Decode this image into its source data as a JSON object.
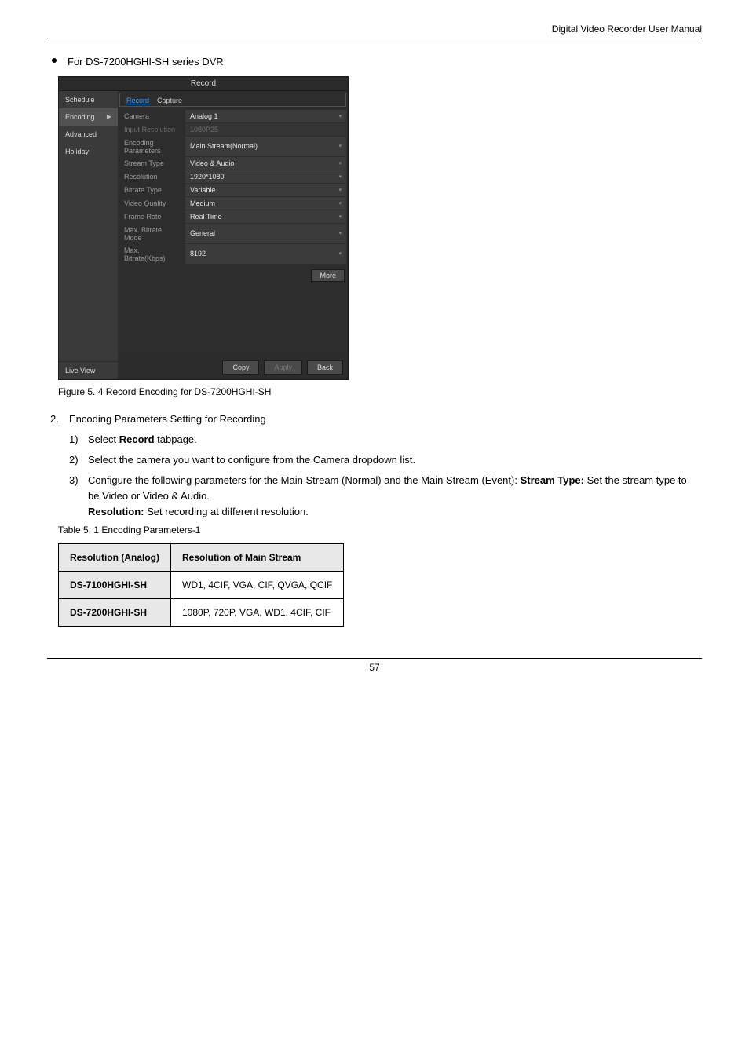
{
  "header": {
    "right": "Digital Video Recorder User Manual"
  },
  "bullet": {
    "text_before": "For ",
    "series": "DS-7200HGHI-SH",
    "text_after": " series DVR:"
  },
  "screenshot": {
    "title": "Record",
    "sidebar": {
      "items": [
        {
          "label": "Schedule",
          "active": false
        },
        {
          "label": "Encoding",
          "active": true
        },
        {
          "label": "Advanced",
          "active": false
        },
        {
          "label": "Holiday",
          "active": false
        }
      ],
      "bottom": "Live View"
    },
    "tabs": [
      {
        "label": "Record",
        "active": true
      },
      {
        "label": "Capture",
        "active": false
      }
    ],
    "rows": [
      {
        "label": "Camera",
        "value": "Analog 1",
        "dd": true
      },
      {
        "label": "Input Resolution",
        "value": "1080P25",
        "dim": true
      },
      {
        "label": "Encoding Parameters",
        "value": "Main Stream(Normal)",
        "dd": true
      },
      {
        "label": "Stream Type",
        "value": "Video & Audio",
        "dd": true
      },
      {
        "label": "Resolution",
        "value": "1920*1080",
        "dd": true
      },
      {
        "label": "Bitrate Type",
        "value": "Variable",
        "dd": true
      },
      {
        "label": "Video Quality",
        "value": "Medium",
        "dd": true
      },
      {
        "label": "Frame Rate",
        "value": "Real Time",
        "dd": true
      },
      {
        "label": "Max. Bitrate Mode",
        "value": "General",
        "dd": true
      },
      {
        "label": "Max. Bitrate(Kbps)",
        "value": "8192",
        "dd": true
      }
    ],
    "more": "More",
    "buttons": {
      "copy": "Copy",
      "apply": "Apply",
      "back": "Back"
    }
  },
  "figure_caption": "Figure 5. 4 Record Encoding for DS-7200HGHI-SH",
  "steps": {
    "s2": {
      "num": "2.",
      "text": "Encoding Parameters Setting for Recording"
    },
    "s2_1": {
      "num": "1)",
      "text": " tabpage."
    }
  },
  "table_caption": "Table 5. 1 Encoding Parameters-1",
  "table": {
    "h1": "Resolution (Analog)",
    "h2": "Resolution of Main Stream",
    "r1c1": "DS-7100HGHI-SH",
    "r1c2": "WD1, 4CIF, VGA, CIF, QVGA, QCIF",
    "r2c1": "DS-7200HGHI-SH",
    "r2c2": "1080P, 720P, VGA, WD1, 4CIF, CIF"
  },
  "footer": {
    "page": "57"
  }
}
